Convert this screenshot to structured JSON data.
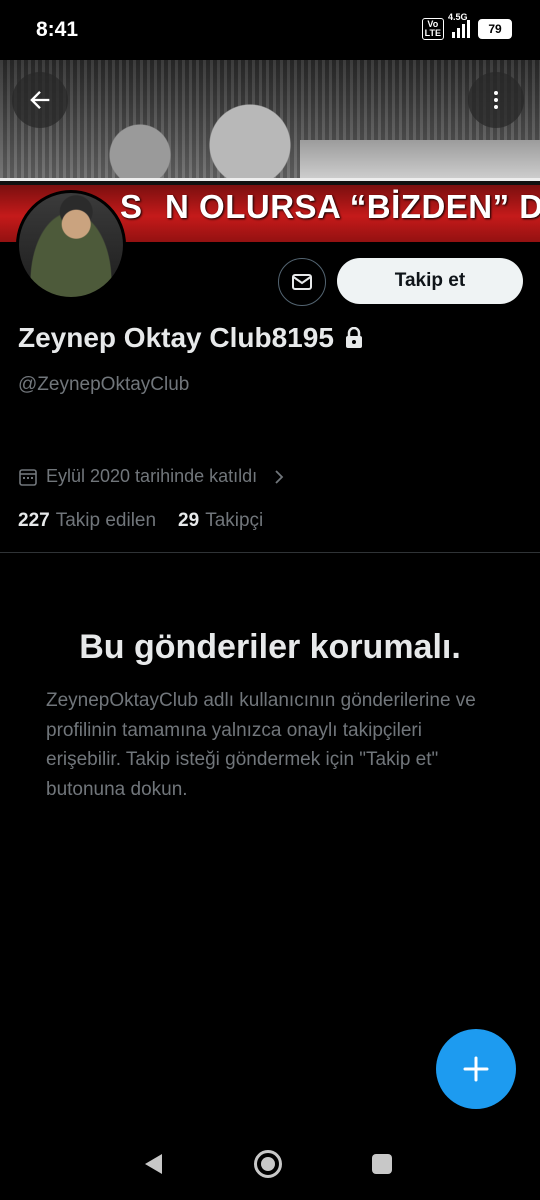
{
  "status_bar": {
    "time": "8:41",
    "volte": "Vo\nLTE",
    "network": "4.5G",
    "battery": "79"
  },
  "banner": {
    "slogan": "SEN OLURSA “BİZDEN” DEĞİL!"
  },
  "profile": {
    "name": "Zeynep Oktay Club8195",
    "handle": "@ZeynepOktayClub",
    "joined": "Eylül 2020 tarihinde katıldı",
    "following_count": "227",
    "following_label": "Takip edilen",
    "followers_count": "29",
    "followers_label": "Takipçi",
    "follow_button": "Takip et"
  },
  "protected": {
    "title": "Bu gönderiler korumalı.",
    "body": "ZeynepOktayClub adlı kullanıcının gönderilerine ve profilinin tamamına yalnızca onaylı takipçileri erişebilir. Takip isteği göndermek için \"Takip et\" butonuna dokun."
  },
  "icons": {
    "back": "arrow-left-icon",
    "more": "more-vertical-icon",
    "message": "envelope-icon",
    "lock": "lock-icon",
    "calendar": "calendar-icon",
    "chevron": "chevron-right-icon",
    "compose": "plus-icon"
  },
  "colors": {
    "accent": "#1d9bf0",
    "background": "#000000",
    "muted": "#71767b",
    "text": "#e7e9ea"
  }
}
